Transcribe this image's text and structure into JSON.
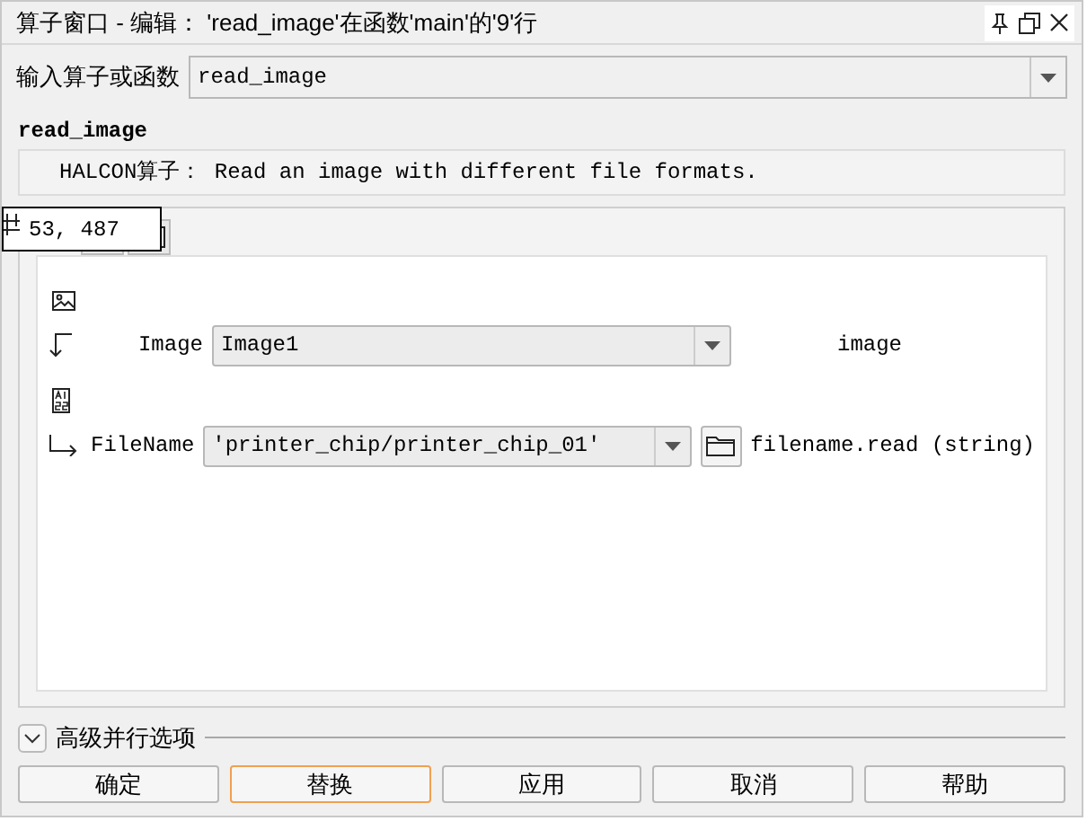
{
  "window": {
    "title": "算子窗口 - 编辑： 'read_image'在函数'main'的'9'行"
  },
  "operator": {
    "label": "输入算子或函数",
    "value": "read_image"
  },
  "operator_name": "read_image",
  "description": "HALCON算子： Read an image with different file formats.",
  "tooltip": "53, 487",
  "parameters": [
    {
      "kind": "output",
      "name": "Image",
      "value": "Image1",
      "type": "image",
      "browse": false
    },
    {
      "kind": "input",
      "name": "FileName",
      "value": "'printer_chip/printer_chip_01'",
      "type": "filename.read (string)",
      "browse": true
    }
  ],
  "advanced": {
    "label": "高级并行选项",
    "expanded": false
  },
  "buttons": [
    {
      "label": "确定",
      "focused": false
    },
    {
      "label": "替换",
      "focused": true
    },
    {
      "label": "应用",
      "focused": false
    },
    {
      "label": "取消",
      "focused": false
    },
    {
      "label": "帮助",
      "focused": false
    }
  ]
}
